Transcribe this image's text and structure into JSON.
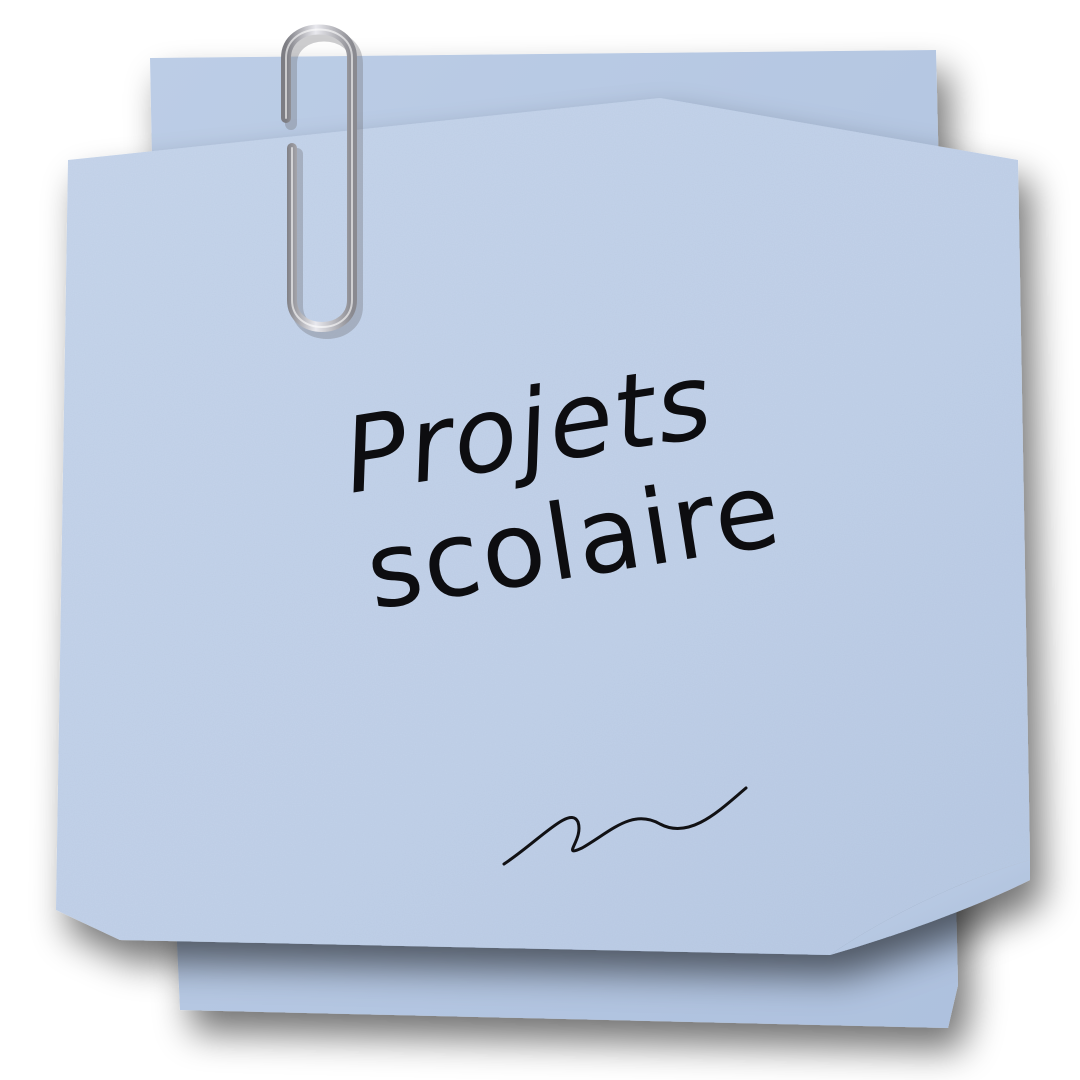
{
  "note": {
    "title_line_1": "Projets",
    "title_line_2": "scolaire"
  },
  "colors": {
    "paper": "#c3d3ea",
    "paper_back": "#b9cae3",
    "ink": "#0d0d10",
    "clip": "#a8a8ad"
  },
  "icons": {
    "clip": "paperclip-icon",
    "squiggle": "squiggle-signature-icon"
  }
}
